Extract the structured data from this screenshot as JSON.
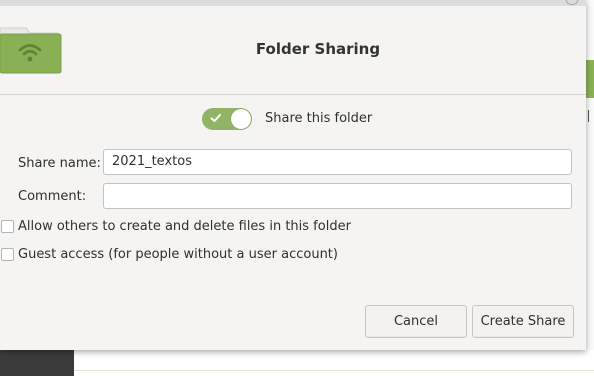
{
  "dialog": {
    "title": "Folder Sharing",
    "share_toggle": {
      "label": "Share this folder",
      "enabled": true
    },
    "share_name": {
      "label": "Share name:",
      "value": "2021_textos"
    },
    "comment": {
      "label": "Comment:",
      "value": ""
    },
    "options": [
      {
        "label": "Allow others to create and delete files in this folder",
        "checked": false
      },
      {
        "label": "Guest access (for people without a user account)",
        "checked": false
      }
    ],
    "buttons": {
      "cancel": "Cancel",
      "create": "Create Share"
    },
    "icons": {
      "header": "folder-wifi-icon",
      "toggle": "check-icon"
    }
  },
  "colors": {
    "accent": "#8fb466",
    "folder": "#8ab055"
  }
}
